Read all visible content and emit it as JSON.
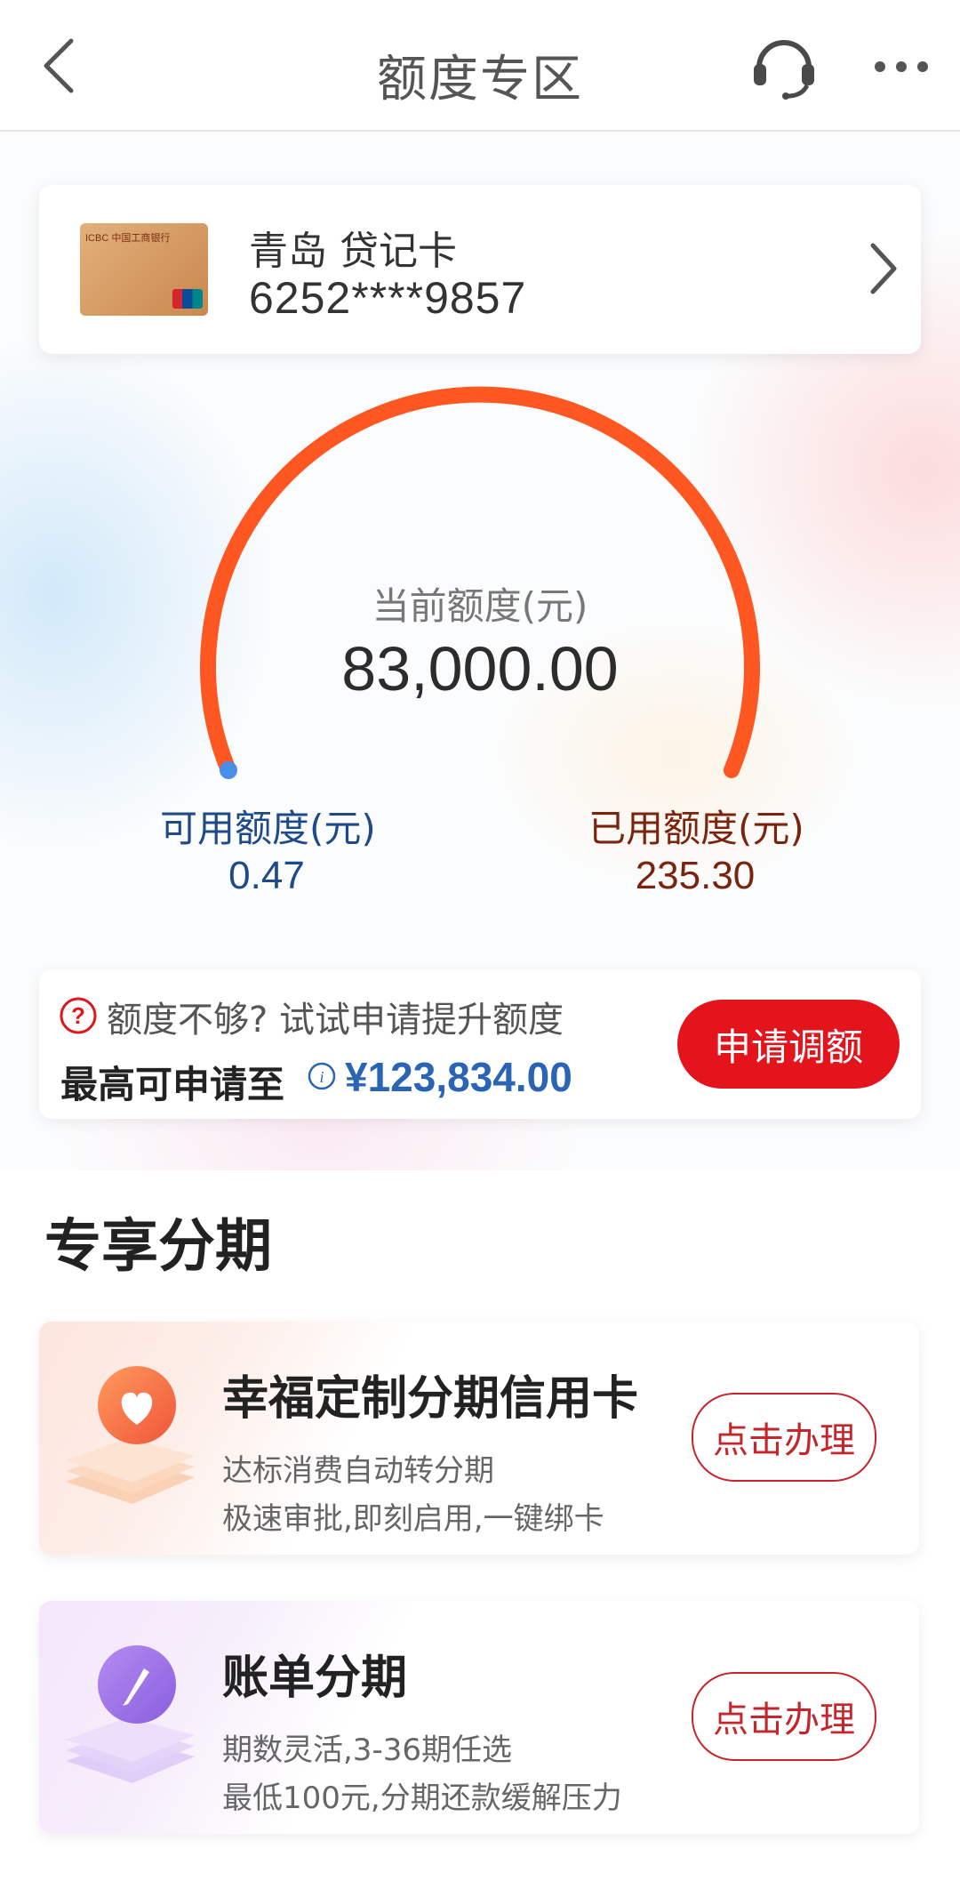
{
  "header": {
    "title": "额度专区",
    "icons": [
      "chevron-left-icon",
      "headset-icon",
      "more-icon"
    ]
  },
  "card": {
    "name": "青岛 贷记卡",
    "number": "6252****9857",
    "thumb_logo": "ICBC 中国工商银行"
  },
  "gauge": {
    "label": "当前额度(元)",
    "value": "83,000.00",
    "arc_color": "#ff5722",
    "indicator_color": "#4a8ee8",
    "available": {
      "label": "可用额度(元)",
      "value": "0.47"
    },
    "used": {
      "label": "已用额度(元)",
      "value": "235.30"
    }
  },
  "raise": {
    "hint": "额度不够? 试试申请提升额度",
    "max_label": "最高可申请至",
    "max_value": "¥123,834.00",
    "button": "申请调额"
  },
  "installments": {
    "section_title": "专享分期",
    "items": [
      {
        "title": "幸福定制分期信用卡",
        "line1": "达标消费自动转分期",
        "line2": "极速审批,即刻启用,一键绑卡",
        "button": "点击办理",
        "icon": "heart-icon"
      },
      {
        "title": "账单分期",
        "line1": "期数灵活,3-36期任选",
        "line2": "最低100元,分期还款缓解压力",
        "button": "点击办理",
        "icon": "pencil-icon"
      }
    ]
  },
  "colors": {
    "accent_red": "#e3141b",
    "link_blue": "#2a64b5",
    "available_blue": "#1f4a8a",
    "used_brown": "#7a2410"
  }
}
